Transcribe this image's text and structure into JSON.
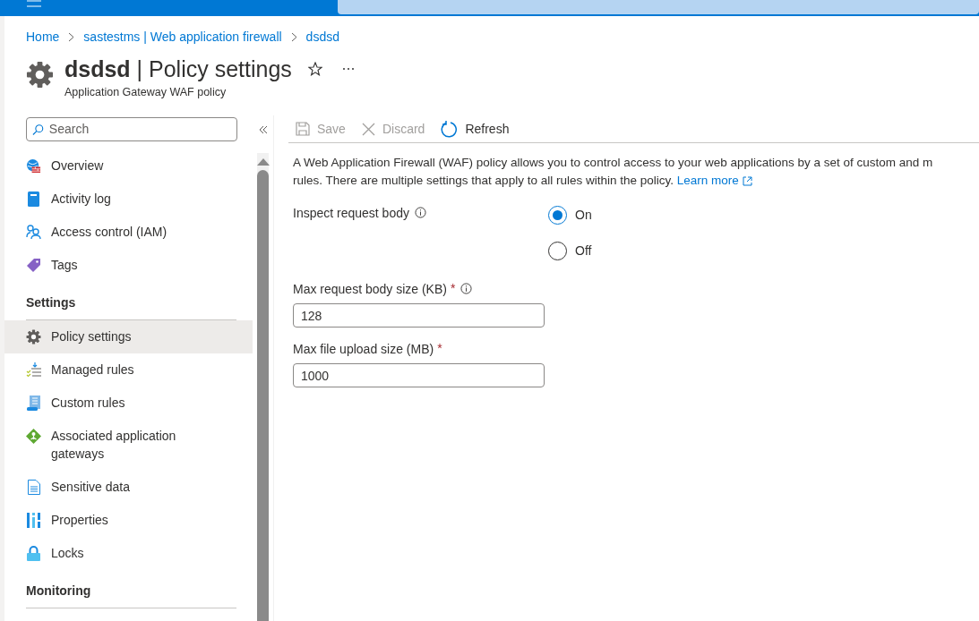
{
  "breadcrumb": [
    "Home",
    "sastestms | Web application firewall",
    "dsdsd"
  ],
  "header": {
    "title": "**dsdsd** | Policy settings",
    "subtitle": "Application Gateway WAF policy"
  },
  "sidebar": {
    "search": {
      "placeholder": "Search"
    },
    "sections": [
      {
        "items": [
          {
            "label": "Overview",
            "selected": false
          },
          {
            "label": "Activity log",
            "selected": false
          },
          {
            "label": "Access control (IAM)",
            "selected": false
          },
          {
            "label": "Tags",
            "selected": false
          }
        ]
      },
      {
        "title": "Settings",
        "items": [
          {
            "label": "Policy settings",
            "selected": true
          },
          {
            "label": "Managed rules",
            "selected": false
          },
          {
            "label": "Custom rules",
            "selected": false
          },
          {
            "label": "Associated application gateways",
            "selected": false
          },
          {
            "label": "Sensitive data",
            "selected": false
          },
          {
            "label": "Properties",
            "selected": false
          },
          {
            "label": "Locks",
            "selected": false
          }
        ]
      },
      {
        "title": "Monitoring"
      }
    ]
  },
  "toolbar": [
    {
      "label": "Save",
      "disabled": true
    },
    {
      "label": "Discard",
      "disabled": true
    },
    {
      "label": "Refresh",
      "disabled": false
    }
  ],
  "description": {
    "lines": [
      "A Web Application Firewall (WAF) policy allows you to control access to your web applications by a set of custom and m",
      "rules. There are multiple settings that apply to all rules within the policy."
    ],
    "link": "Learn more"
  },
  "inspect_request_body": {
    "label": "Inspect request body",
    "info": true,
    "options": [
      {
        "label": "On",
        "selected": true
      },
      {
        "label": "Off",
        "selected": false
      }
    ]
  },
  "fields": [
    {
      "label": "Max request body size (KB)",
      "required_mark": "*",
      "info": true,
      "value": "128"
    },
    {
      "label": "Max file upload size (MB)",
      "required_mark": "*",
      "value": "1000"
    }
  ]
}
